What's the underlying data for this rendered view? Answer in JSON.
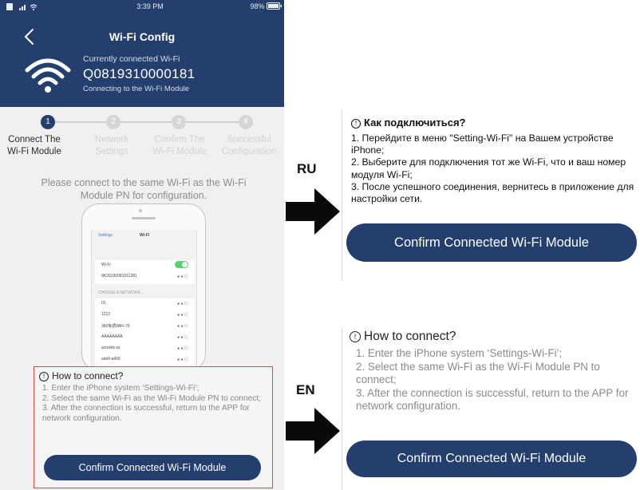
{
  "status_bar": {
    "time": "3:39 PM",
    "battery": "98%"
  },
  "header": {
    "title": "Wi-Fi Config",
    "connected_caption": "Currently connected Wi-Fi",
    "ssid": "Q0819310000181",
    "status": "Connecting to the Wi-Fi Module"
  },
  "steps": [
    {
      "number": "1",
      "line1": "Connect The",
      "line2": "Wi-Fi Module",
      "active": true
    },
    {
      "number": "2",
      "line1": "Network",
      "line2": "Settings",
      "active": false
    },
    {
      "number": "3",
      "line1": "Confirm The",
      "line2": "Wi-Fi Module",
      "active": false
    },
    {
      "number": "4",
      "line1": "Successful",
      "line2": "Configuration",
      "active": false
    }
  ],
  "instruction": "Please connect to the same Wi-Fi as the Wi-Fi Module PN for configuration.",
  "mock_screen": {
    "back": "Settings",
    "title": "Wi-Fi",
    "wifi_label": "Wi-Fi",
    "connected_network": "9K20190081011281",
    "choose_label": "CHOOSE A NETWORK...",
    "networks": [
      "01",
      "1212",
      "360免费WiFi-70",
      "AAAAAAAA",
      "actolink-sz",
      "airbfi-a456"
    ]
  },
  "phone_help": {
    "title": "How to connect?",
    "lines": [
      "1. Enter the iPhone system ‘Settings-Wi-Fi’;",
      "2. Select the same Wi-Fi as the Wi-Fi Module PN to connect;",
      "3. After the connection is successful, return to the APP for network configuration."
    ],
    "button": "Confirm Connected Wi-Fi Module"
  },
  "labels": {
    "ru": "RU",
    "en": "EN"
  },
  "ru_panel": {
    "title": "Как подключиться?",
    "lines": [
      "1. Перейдите в меню \"Setting-Wi-Fi\" на Вашем устройстве iPhone;",
      "2. Выберите для подключения тот же Wi-Fi, что и ваш номер модуля Wi-Fi;",
      "3. После успешного соединения, вернитесь в приложение для настройки сети."
    ],
    "button": "Confirm Connected Wi-Fi Module"
  },
  "en_panel": {
    "title": "How to connect?",
    "lines": [
      "1. Enter the iPhone system ‘Settings-Wi-Fi’;",
      "2. Select the same Wi-Fi as the Wi-Fi Module PN to connect;",
      "3. After the connection is successful, return to the APP for network configuration."
    ],
    "button": "Confirm Connected Wi-Fi Module"
  },
  "colors": {
    "primary": "#243f6e",
    "highlight_border": "#e04848",
    "toggle_on": "#4cd964"
  }
}
